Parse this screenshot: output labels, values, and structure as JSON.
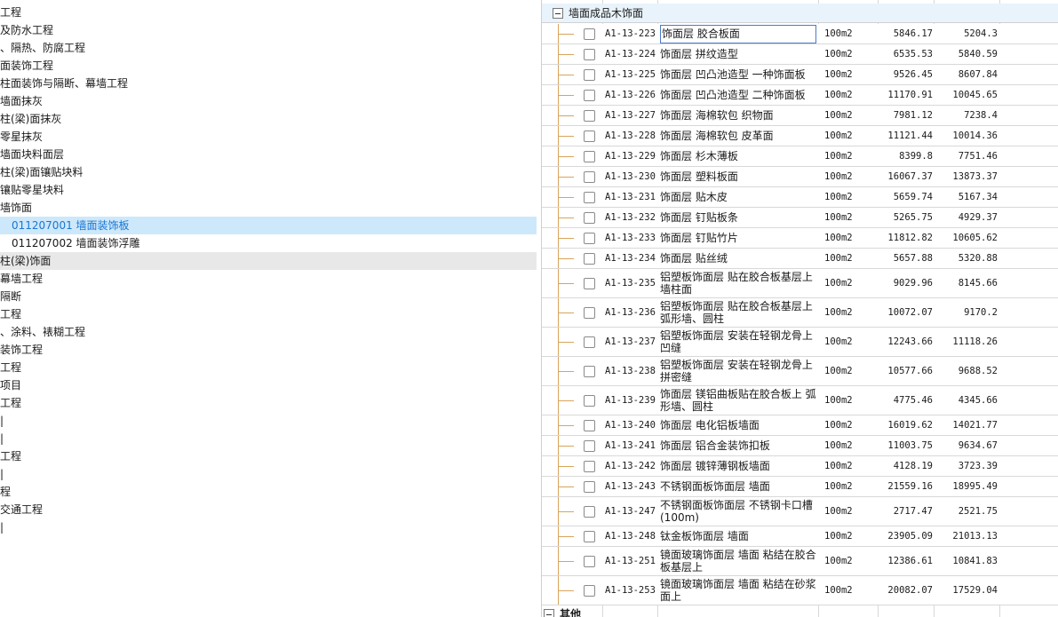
{
  "tree": [
    {
      "text": "工程"
    },
    {
      "text": "及防水工程"
    },
    {
      "text": "、隔热、防腐工程"
    },
    {
      "text": "面装饰工程"
    },
    {
      "text": "柱面装饰与隔断、幕墙工程"
    },
    {
      "text": "墙面抹灰"
    },
    {
      "text": "柱(梁)面抹灰"
    },
    {
      "text": "零星抹灰"
    },
    {
      "text": "墙面块料面层"
    },
    {
      "text": "柱(梁)面镶贴块料"
    },
    {
      "text": "镶贴零星块料"
    },
    {
      "text": "墙饰面"
    },
    {
      "text": "011207001  墙面装饰板",
      "state": "selected"
    },
    {
      "text": "011207002  墙面装饰浮雕"
    },
    {
      "text": "柱(梁)饰面",
      "state": "hover"
    },
    {
      "text": "幕墙工程"
    },
    {
      "text": "隔断"
    },
    {
      "text": "工程"
    },
    {
      "text": "、涂料、裱糊工程"
    },
    {
      "text": "装饰工程"
    },
    {
      "text": "工程"
    },
    {
      "text": "项目"
    },
    {
      "text": "工程"
    },
    {
      "text": "|"
    },
    {
      "text": "|"
    },
    {
      "text": "工程"
    },
    {
      "text": "|"
    },
    {
      "text": "程"
    },
    {
      "text": "交通工程"
    },
    {
      "text": "|"
    }
  ],
  "group": {
    "label": "墙面成品木饰面"
  },
  "bottom_group": {
    "label": "其他"
  },
  "rows": [
    {
      "code": "A1-13-223",
      "name": "饰面层 胶合板面",
      "unit": "100m2",
      "v1": "5846.17",
      "v2": "5204.3"
    },
    {
      "code": "A1-13-224",
      "name": "饰面层 拼纹造型",
      "unit": "100m2",
      "v1": "6535.53",
      "v2": "5840.59"
    },
    {
      "code": "A1-13-225",
      "name": "饰面层 凹凸池造型 一种饰面板",
      "unit": "100m2",
      "v1": "9526.45",
      "v2": "8607.84"
    },
    {
      "code": "A1-13-226",
      "name": "饰面层 凹凸池造型 二种饰面板",
      "unit": "100m2",
      "v1": "11170.91",
      "v2": "10045.65"
    },
    {
      "code": "A1-13-227",
      "name": "饰面层 海棉软包 织物面",
      "unit": "100m2",
      "v1": "7981.12",
      "v2": "7238.4"
    },
    {
      "code": "A1-13-228",
      "name": "饰面层 海棉软包 皮革面",
      "unit": "100m2",
      "v1": "11121.44",
      "v2": "10014.36"
    },
    {
      "code": "A1-13-229",
      "name": "饰面层 杉木薄板",
      "unit": "100m2",
      "v1": "8399.8",
      "v2": "7751.46"
    },
    {
      "code": "A1-13-230",
      "name": "饰面层 塑料板面",
      "unit": "100m2",
      "v1": "16067.37",
      "v2": "13873.37"
    },
    {
      "code": "A1-13-231",
      "name": "饰面层 贴木皮",
      "unit": "100m2",
      "v1": "5659.74",
      "v2": "5167.34"
    },
    {
      "code": "A1-13-232",
      "name": "饰面层 钉贴板条",
      "unit": "100m2",
      "v1": "5265.75",
      "v2": "4929.37"
    },
    {
      "code": "A1-13-233",
      "name": "饰面层 钉贴竹片",
      "unit": "100m2",
      "v1": "11812.82",
      "v2": "10605.62"
    },
    {
      "code": "A1-13-234",
      "name": "饰面层 贴丝绒",
      "unit": "100m2",
      "v1": "5657.88",
      "v2": "5320.88"
    },
    {
      "code": "A1-13-235",
      "name": "铝塑板饰面层 贴在胶合板基层上 墙柱面",
      "unit": "100m2",
      "v1": "9029.96",
      "v2": "8145.66"
    },
    {
      "code": "A1-13-236",
      "name": "铝塑板饰面层 贴在胶合板基层上 弧形墙、圆柱",
      "unit": "100m2",
      "v1": "10072.07",
      "v2": "9170.2"
    },
    {
      "code": "A1-13-237",
      "name": "铝塑板饰面层 安装在轻钢龙骨上 凹缝",
      "unit": "100m2",
      "v1": "12243.66",
      "v2": "11118.26"
    },
    {
      "code": "A1-13-238",
      "name": "铝塑板饰面层 安装在轻钢龙骨上 拼密缝",
      "unit": "100m2",
      "v1": "10577.66",
      "v2": "9688.52"
    },
    {
      "code": "A1-13-239",
      "name": "饰面层 镁铝曲板贴在胶合板上 弧形墙、圆柱",
      "unit": "100m2",
      "v1": "4775.46",
      "v2": "4345.66"
    },
    {
      "code": "A1-13-240",
      "name": "饰面层 电化铝板墙面",
      "unit": "100m2",
      "v1": "16019.62",
      "v2": "14021.77"
    },
    {
      "code": "A1-13-241",
      "name": "饰面层 铝合金装饰扣板",
      "unit": "100m2",
      "v1": "11003.75",
      "v2": "9634.67"
    },
    {
      "code": "A1-13-242",
      "name": "饰面层 镀锌薄钢板墙面",
      "unit": "100m2",
      "v1": "4128.19",
      "v2": "3723.39"
    },
    {
      "code": "A1-13-243",
      "name": "不锈钢面板饰面层 墙面",
      "unit": "100m2",
      "v1": "21559.16",
      "v2": "18995.49"
    },
    {
      "code": "A1-13-247",
      "name": "不锈钢面板饰面层 不锈钢卡口槽 (100m)",
      "unit": "100m2",
      "v1": "2717.47",
      "v2": "2521.75"
    },
    {
      "code": "A1-13-248",
      "name": "钛金板饰面层 墙面",
      "unit": "100m2",
      "v1": "23905.09",
      "v2": "21013.13"
    },
    {
      "code": "A1-13-251",
      "name": "镜面玻璃饰面层 墙面 粘结在胶合板基层上",
      "unit": "100m2",
      "v1": "12386.61",
      "v2": "10841.83"
    },
    {
      "code": "A1-13-253",
      "name": "镜面玻璃饰面层 墙面 粘结在砂浆面上",
      "unit": "100m2",
      "v1": "20082.07",
      "v2": "17529.04"
    }
  ]
}
